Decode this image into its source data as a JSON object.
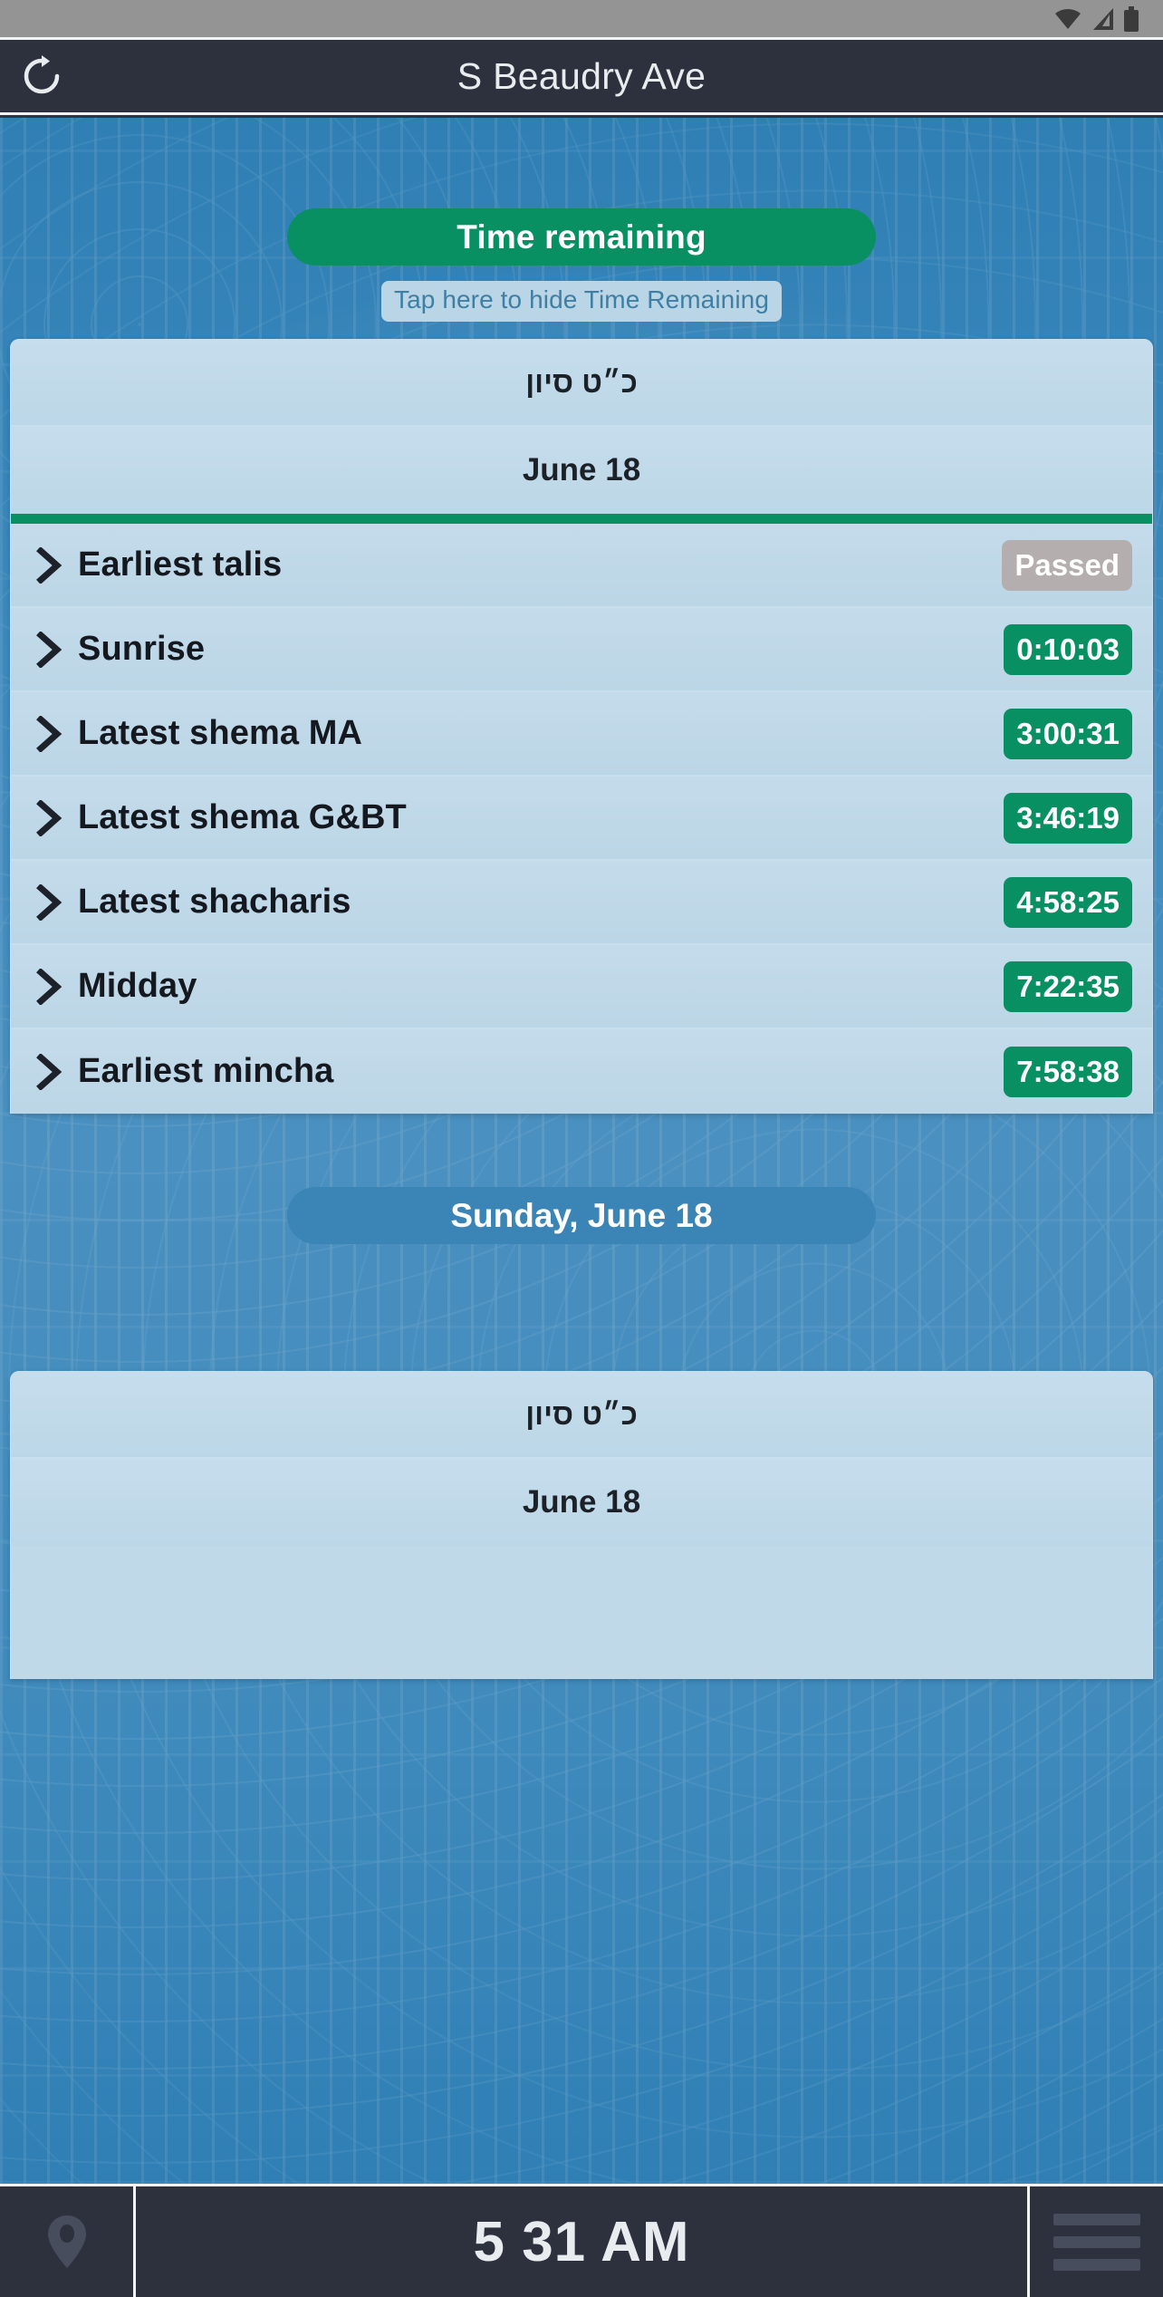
{
  "statusbar": {
    "icons": [
      "wifi-icon",
      "cell-signal-icon",
      "battery-icon"
    ]
  },
  "titlebar": {
    "refresh_icon": "refresh-icon",
    "title": "S Beaudry Ave"
  },
  "time_remaining": {
    "button_label": "Time remaining",
    "hide_hint": "Tap here to hide Time Remaining"
  },
  "card_top": {
    "hebrew_date": "כ״ט סיון",
    "gregorian_date": "June 18"
  },
  "zmanim": [
    {
      "chevron": "chevron-right-icon",
      "label": "Earliest talis",
      "value": "Passed",
      "state": "passed"
    },
    {
      "chevron": "chevron-right-icon",
      "label": "Sunrise",
      "value": "0:10:03",
      "state": "countdown"
    },
    {
      "chevron": "chevron-right-icon",
      "label": "Latest shema MA",
      "value": "3:00:31",
      "state": "countdown"
    },
    {
      "chevron": "chevron-right-icon",
      "label": "Latest shema G&BT",
      "value": "3:46:19",
      "state": "countdown"
    },
    {
      "chevron": "chevron-right-icon",
      "label": "Latest shacharis",
      "value": "4:58:25",
      "state": "countdown"
    },
    {
      "chevron": "chevron-right-icon",
      "label": "Midday",
      "value": "7:22:35",
      "state": "countdown"
    },
    {
      "chevron": "chevron-right-icon",
      "label": "Earliest mincha",
      "value": "7:58:38",
      "state": "countdown"
    }
  ],
  "day_pill": {
    "label": "Sunday, June 18"
  },
  "card_bottom": {
    "hebrew_date": "כ״ט סיון",
    "gregorian_date": "June 18"
  },
  "bottombar": {
    "location_icon": "location-pin-icon",
    "clock": "5 31 AM",
    "menu_icon": "hamburger-menu-icon"
  },
  "colors": {
    "accent_green": "#089063",
    "passed_gray": "#b4aeae",
    "bar_dark": "#2d313d",
    "pill_blue": "#3a84b6",
    "card_blue": "#bfd9e8"
  }
}
